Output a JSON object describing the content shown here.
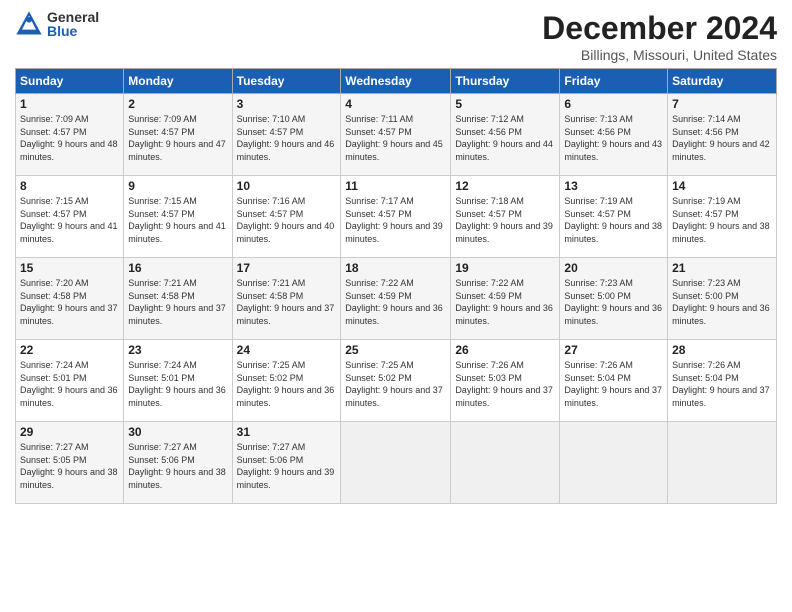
{
  "header": {
    "logo_general": "General",
    "logo_blue": "Blue",
    "title": "December 2024",
    "subtitle": "Billings, Missouri, United States"
  },
  "calendar": {
    "days_of_week": [
      "Sunday",
      "Monday",
      "Tuesday",
      "Wednesday",
      "Thursday",
      "Friday",
      "Saturday"
    ],
    "weeks": [
      [
        {
          "day": "",
          "empty": true
        },
        {
          "day": "",
          "empty": true
        },
        {
          "day": "",
          "empty": true
        },
        {
          "day": "",
          "empty": true
        },
        {
          "day": "",
          "empty": true
        },
        {
          "day": "",
          "empty": true
        },
        {
          "day": "",
          "empty": true
        }
      ],
      [
        {
          "day": "1",
          "sunrise": "Sunrise: 7:09 AM",
          "sunset": "Sunset: 4:57 PM",
          "daylight": "Daylight: 9 hours and 48 minutes."
        },
        {
          "day": "2",
          "sunrise": "Sunrise: 7:09 AM",
          "sunset": "Sunset: 4:57 PM",
          "daylight": "Daylight: 9 hours and 47 minutes."
        },
        {
          "day": "3",
          "sunrise": "Sunrise: 7:10 AM",
          "sunset": "Sunset: 4:57 PM",
          "daylight": "Daylight: 9 hours and 46 minutes."
        },
        {
          "day": "4",
          "sunrise": "Sunrise: 7:11 AM",
          "sunset": "Sunset: 4:57 PM",
          "daylight": "Daylight: 9 hours and 45 minutes."
        },
        {
          "day": "5",
          "sunrise": "Sunrise: 7:12 AM",
          "sunset": "Sunset: 4:56 PM",
          "daylight": "Daylight: 9 hours and 44 minutes."
        },
        {
          "day": "6",
          "sunrise": "Sunrise: 7:13 AM",
          "sunset": "Sunset: 4:56 PM",
          "daylight": "Daylight: 9 hours and 43 minutes."
        },
        {
          "day": "7",
          "sunrise": "Sunrise: 7:14 AM",
          "sunset": "Sunset: 4:56 PM",
          "daylight": "Daylight: 9 hours and 42 minutes."
        }
      ],
      [
        {
          "day": "8",
          "sunrise": "Sunrise: 7:15 AM",
          "sunset": "Sunset: 4:57 PM",
          "daylight": "Daylight: 9 hours and 41 minutes."
        },
        {
          "day": "9",
          "sunrise": "Sunrise: 7:15 AM",
          "sunset": "Sunset: 4:57 PM",
          "daylight": "Daylight: 9 hours and 41 minutes."
        },
        {
          "day": "10",
          "sunrise": "Sunrise: 7:16 AM",
          "sunset": "Sunset: 4:57 PM",
          "daylight": "Daylight: 9 hours and 40 minutes."
        },
        {
          "day": "11",
          "sunrise": "Sunrise: 7:17 AM",
          "sunset": "Sunset: 4:57 PM",
          "daylight": "Daylight: 9 hours and 39 minutes."
        },
        {
          "day": "12",
          "sunrise": "Sunrise: 7:18 AM",
          "sunset": "Sunset: 4:57 PM",
          "daylight": "Daylight: 9 hours and 39 minutes."
        },
        {
          "day": "13",
          "sunrise": "Sunrise: 7:19 AM",
          "sunset": "Sunset: 4:57 PM",
          "daylight": "Daylight: 9 hours and 38 minutes."
        },
        {
          "day": "14",
          "sunrise": "Sunrise: 7:19 AM",
          "sunset": "Sunset: 4:57 PM",
          "daylight": "Daylight: 9 hours and 38 minutes."
        }
      ],
      [
        {
          "day": "15",
          "sunrise": "Sunrise: 7:20 AM",
          "sunset": "Sunset: 4:58 PM",
          "daylight": "Daylight: 9 hours and 37 minutes."
        },
        {
          "day": "16",
          "sunrise": "Sunrise: 7:21 AM",
          "sunset": "Sunset: 4:58 PM",
          "daylight": "Daylight: 9 hours and 37 minutes."
        },
        {
          "day": "17",
          "sunrise": "Sunrise: 7:21 AM",
          "sunset": "Sunset: 4:58 PM",
          "daylight": "Daylight: 9 hours and 37 minutes."
        },
        {
          "day": "18",
          "sunrise": "Sunrise: 7:22 AM",
          "sunset": "Sunset: 4:59 PM",
          "daylight": "Daylight: 9 hours and 36 minutes."
        },
        {
          "day": "19",
          "sunrise": "Sunrise: 7:22 AM",
          "sunset": "Sunset: 4:59 PM",
          "daylight": "Daylight: 9 hours and 36 minutes."
        },
        {
          "day": "20",
          "sunrise": "Sunrise: 7:23 AM",
          "sunset": "Sunset: 5:00 PM",
          "daylight": "Daylight: 9 hours and 36 minutes."
        },
        {
          "day": "21",
          "sunrise": "Sunrise: 7:23 AM",
          "sunset": "Sunset: 5:00 PM",
          "daylight": "Daylight: 9 hours and 36 minutes."
        }
      ],
      [
        {
          "day": "22",
          "sunrise": "Sunrise: 7:24 AM",
          "sunset": "Sunset: 5:01 PM",
          "daylight": "Daylight: 9 hours and 36 minutes."
        },
        {
          "day": "23",
          "sunrise": "Sunrise: 7:24 AM",
          "sunset": "Sunset: 5:01 PM",
          "daylight": "Daylight: 9 hours and 36 minutes."
        },
        {
          "day": "24",
          "sunrise": "Sunrise: 7:25 AM",
          "sunset": "Sunset: 5:02 PM",
          "daylight": "Daylight: 9 hours and 36 minutes."
        },
        {
          "day": "25",
          "sunrise": "Sunrise: 7:25 AM",
          "sunset": "Sunset: 5:02 PM",
          "daylight": "Daylight: 9 hours and 37 minutes."
        },
        {
          "day": "26",
          "sunrise": "Sunrise: 7:26 AM",
          "sunset": "Sunset: 5:03 PM",
          "daylight": "Daylight: 9 hours and 37 minutes."
        },
        {
          "day": "27",
          "sunrise": "Sunrise: 7:26 AM",
          "sunset": "Sunset: 5:04 PM",
          "daylight": "Daylight: 9 hours and 37 minutes."
        },
        {
          "day": "28",
          "sunrise": "Sunrise: 7:26 AM",
          "sunset": "Sunset: 5:04 PM",
          "daylight": "Daylight: 9 hours and 37 minutes."
        }
      ],
      [
        {
          "day": "29",
          "sunrise": "Sunrise: 7:27 AM",
          "sunset": "Sunset: 5:05 PM",
          "daylight": "Daylight: 9 hours and 38 minutes."
        },
        {
          "day": "30",
          "sunrise": "Sunrise: 7:27 AM",
          "sunset": "Sunset: 5:06 PM",
          "daylight": "Daylight: 9 hours and 38 minutes."
        },
        {
          "day": "31",
          "sunrise": "Sunrise: 7:27 AM",
          "sunset": "Sunset: 5:06 PM",
          "daylight": "Daylight: 9 hours and 39 minutes."
        },
        {
          "day": "",
          "empty": true
        },
        {
          "day": "",
          "empty": true
        },
        {
          "day": "",
          "empty": true
        },
        {
          "day": "",
          "empty": true
        }
      ]
    ]
  }
}
